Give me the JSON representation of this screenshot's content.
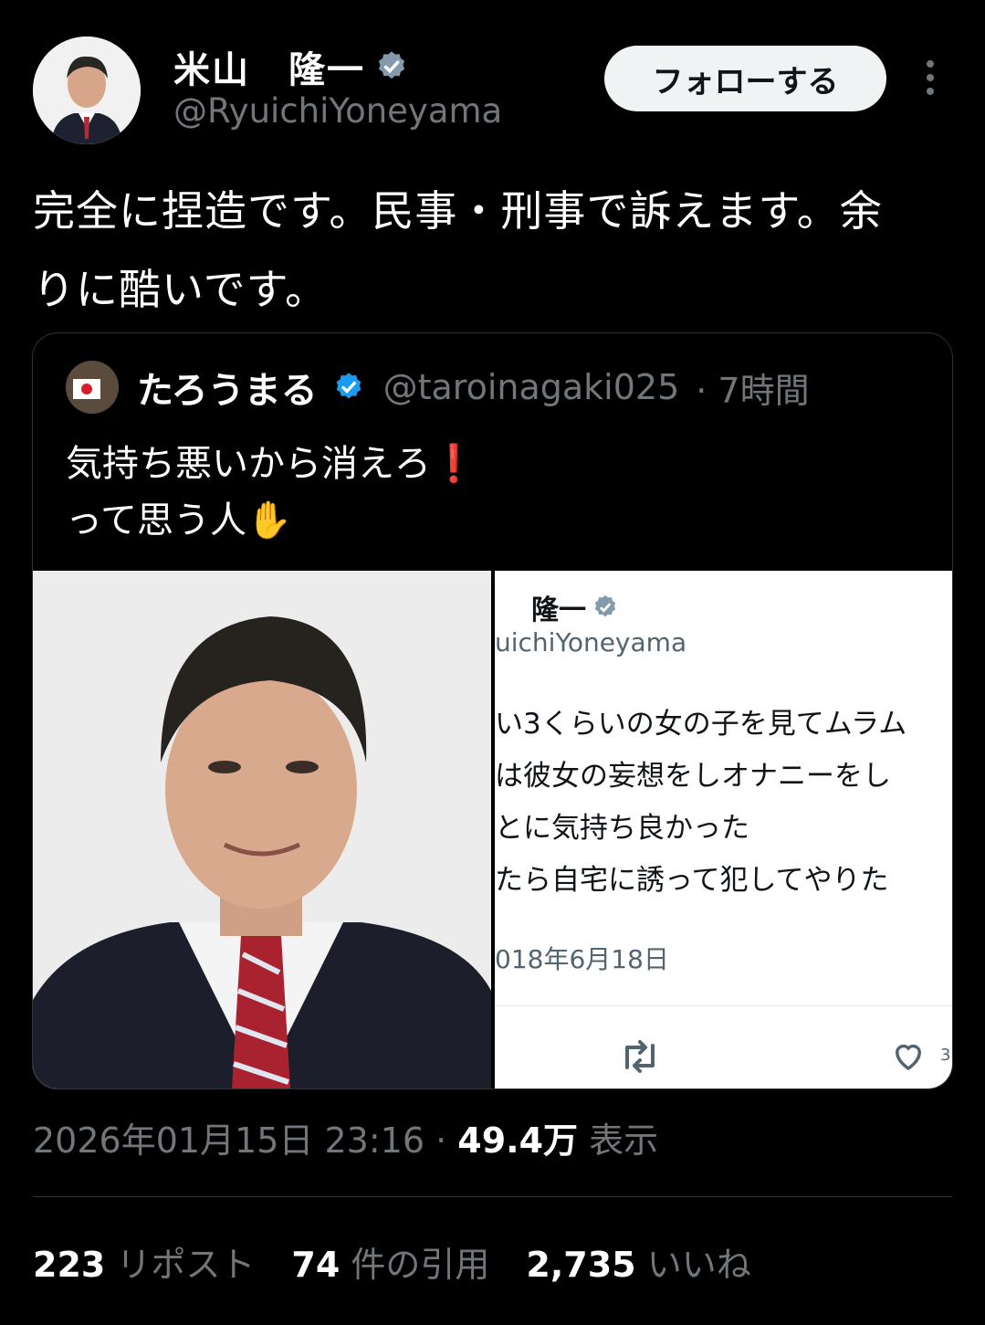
{
  "author": {
    "display_name": "米山　隆一",
    "handle": "@RyuichiYoneyama",
    "verified": true,
    "avatar_icon": "person-photo"
  },
  "follow_label": "フォローする",
  "more_icon": "more-vertical-icon",
  "tweet_text": "完全に捏造です。民事・刑事で訴えます。余りに酷いです。",
  "quote": {
    "display_name": "たろうまる",
    "handle": "@taroinagaki025",
    "time": "· 7時間",
    "line1": "気持ち悪いから消えろ❗",
    "line2": "って思う人✋",
    "screenshot": {
      "name": "隆一",
      "handle": "uichiYoneyama",
      "lines": [
        "い3くらいの女の子を見てムラム",
        "は彼女の妄想をしオナニーをし",
        "とに気持ち良かった",
        "たら自宅に誘って犯してやりた"
      ],
      "date": "018年6月18日",
      "like_count": "3"
    }
  },
  "meta": {
    "datetime": "2026年01月15日 23:16",
    "sep": " · ",
    "views": "49.4万",
    "views_label": " 表示"
  },
  "stats": {
    "reposts": "223",
    "reposts_label": " リポスト",
    "quotes": "74",
    "quotes_label": " 件の引用",
    "likes": "2,735",
    "likes_label": " いいね"
  },
  "colors": {
    "verified": "#1d9bf0",
    "background": "#000000",
    "muted": "#71767b"
  }
}
